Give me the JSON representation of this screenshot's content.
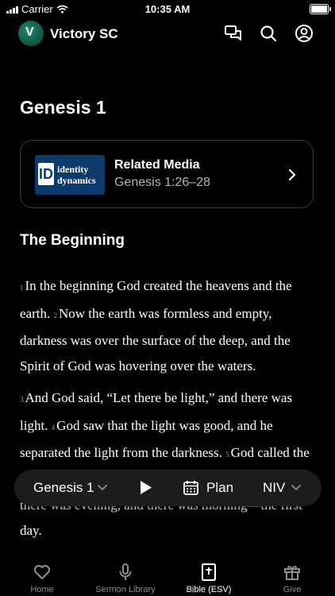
{
  "status_bar": {
    "carrier": "Carrier",
    "time": "10:35 AM"
  },
  "header": {
    "org_name": "Victory SC",
    "logo_letter": "V"
  },
  "page_title": "Genesis 1",
  "related_media": {
    "heading": "Related Media",
    "reference": "Genesis 1:26–28",
    "thumb_badge": "ID",
    "thumb_line1": "identity",
    "thumb_line2": "dynamics"
  },
  "section_heading": "The Beginning",
  "scripture": {
    "paragraph1": [
      {
        "num": "1",
        "text": "In the beginning God created the heavens and the earth. "
      },
      {
        "num": "2",
        "text": "Now the earth was formless and empty, darkness was over the surface of the deep, and the Spirit of God was hovering over the waters."
      }
    ],
    "paragraph2": [
      {
        "num": "3",
        "text": "And God said, “Let there be light,” and there was light. "
      },
      {
        "num": "4",
        "text": "God saw that the light was good, and he separated the light from the darkness. "
      },
      {
        "num": "5",
        "text": "God called the light “day,” and the darkness he called “night.” And there was evening, and there was morning—the first day."
      }
    ]
  },
  "player": {
    "chapter": "Genesis 1",
    "plan_label": "Plan",
    "version": "NIV"
  },
  "tabs": [
    {
      "label": "Home",
      "icon": "heart-icon"
    },
    {
      "label": "Sermon Library",
      "icon": "microphone-icon"
    },
    {
      "label": "Bible (ESV)",
      "icon": "bible-icon",
      "active": true
    },
    {
      "label": "Give",
      "icon": "gift-icon"
    }
  ]
}
